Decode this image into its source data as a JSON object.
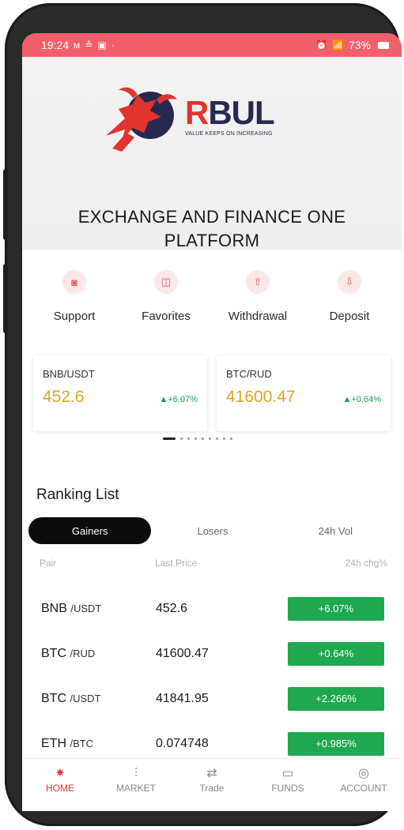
{
  "status_bar": {
    "time": "19:24",
    "left_icons": [
      "m-icon",
      "notification-icon",
      "image-icon",
      "dot-icon"
    ],
    "battery": "73%"
  },
  "brand": {
    "name_first": "R",
    "name_rest": "BUL",
    "tagline": "VALUE KEEPS ON INCREASING"
  },
  "hero": {
    "headline_line1": "EXCHANGE AND FINANCE ONE",
    "headline_line2": "PLATFORM"
  },
  "actions": [
    {
      "label": "Support",
      "icon": "support-icon"
    },
    {
      "label": "Favorites",
      "icon": "favorites-icon"
    },
    {
      "label": "Withdrawal",
      "icon": "withdrawal-icon"
    },
    {
      "label": "Deposit",
      "icon": "deposit-icon"
    }
  ],
  "tickers": [
    {
      "pair": "BNB/USDT",
      "price": "452.6",
      "change": "▲+6.07%"
    },
    {
      "pair": "BTC/RUD",
      "price": "41600.47",
      "change": "▲+0.64%"
    }
  ],
  "ranking": {
    "title": "Ranking List",
    "tabs": [
      "Gainers",
      "Losers",
      "24h Vol"
    ],
    "active_tab": "Gainers",
    "columns": [
      "Pair",
      "Last Price",
      "24h chg%"
    ],
    "rows": [
      {
        "base": "BNB",
        "quote": "/USDT",
        "price": "452.6",
        "change": "+6.07%"
      },
      {
        "base": "BTC",
        "quote": "/RUD",
        "price": "41600.47",
        "change": "+0.64%"
      },
      {
        "base": "BTC",
        "quote": "/USDT",
        "price": "41841.95",
        "change": "+2.266%"
      },
      {
        "base": "ETH",
        "quote": "/BTC",
        "price": "0.074748",
        "change": "+0.985%"
      }
    ]
  },
  "bottom_nav": [
    {
      "label": "HOME",
      "icon": "home-bull-icon",
      "active": true
    },
    {
      "label": "MARKET",
      "icon": "market-icon",
      "active": false
    },
    {
      "label": "Trade",
      "icon": "trade-icon",
      "active": false
    },
    {
      "label": "FUNDS",
      "icon": "funds-icon",
      "active": false
    },
    {
      "label": "ACCOUNT",
      "icon": "account-icon",
      "active": false
    }
  ],
  "colors": {
    "status_bar": "#f1606a",
    "brand_navy": "#262a52",
    "brand_red": "#e0342c",
    "price_gold": "#d7a824",
    "gain_green": "#1fa84f"
  }
}
